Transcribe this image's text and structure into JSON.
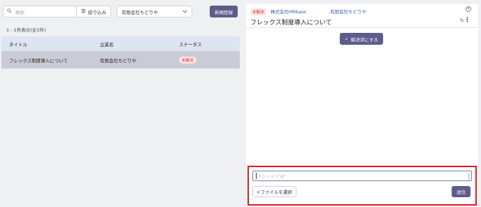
{
  "left": {
    "search": {
      "placeholder": "検索",
      "icon": "search-icon"
    },
    "filter_button": {
      "label": "絞り込み",
      "icon": "filter-icon"
    },
    "company_select": {
      "value": "有限会社ちどりや",
      "icon": "chevron-down-icon"
    },
    "new_button": {
      "label": "新規登録"
    },
    "count_text": "1 - 1件表示(全1件)",
    "table": {
      "headers": [
        "タイトル",
        "企業名",
        "ステータス"
      ],
      "rows": [
        {
          "title": "フレックス制度導入について",
          "company": "有限会社ちどりや",
          "status": "未解決"
        }
      ]
    }
  },
  "right": {
    "status_badge": "未解決",
    "company_primary": "株式会社HRbase",
    "company_secondary": ",有限会社ちどりや",
    "title": "フレックス制度導入について",
    "resolve_button": {
      "label": "解決済にする",
      "icon": "check-icon"
    },
    "compose": {
      "input_placeholder": "メンション\"@\"",
      "file_button": "+ファイルを選択",
      "send_button": "送信"
    },
    "icons": {
      "close": "close-circle-icon",
      "edit": "pencil-icon",
      "more": "more-vertical-icon"
    }
  },
  "colors": {
    "primary_button": "#5e5c8c",
    "badge_bg": "#fde3e3",
    "badge_text": "#d33333",
    "highlight_border": "#e0191f",
    "table_header": "#dde5f3",
    "selected_row": "#c9ccd4",
    "link": "#3a5aa8"
  }
}
